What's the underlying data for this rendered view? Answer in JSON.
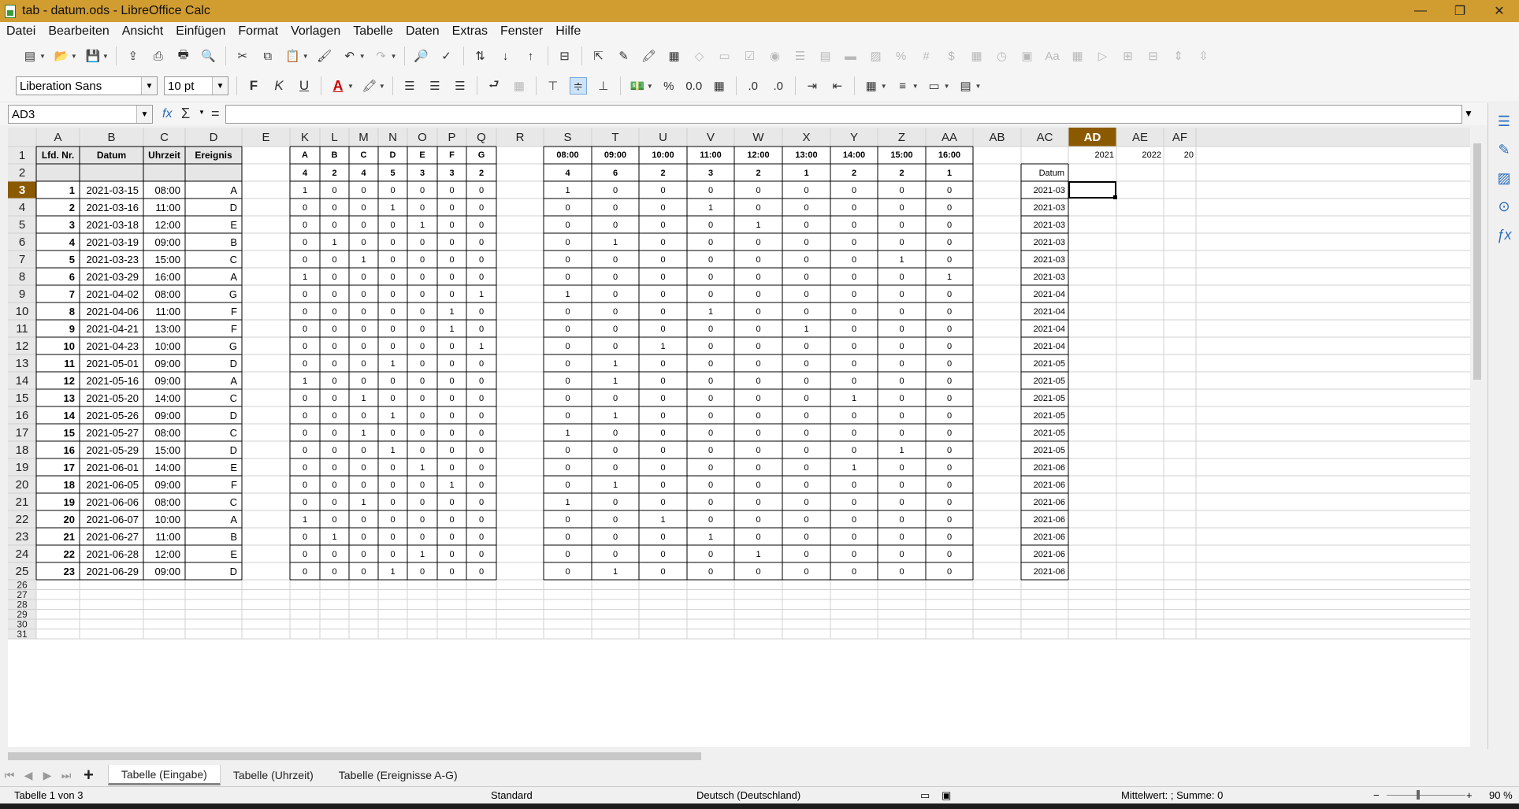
{
  "window": {
    "title": "tab - datum.ods - LibreOffice Calc",
    "minimize": "—",
    "restore": "❐",
    "close": "✕"
  },
  "menu": [
    "Datei",
    "Bearbeiten",
    "Ansicht",
    "Einfügen",
    "Format",
    "Vorlagen",
    "Tabelle",
    "Daten",
    "Extras",
    "Fenster",
    "Hilfe"
  ],
  "toolbar": {
    "font_name": "Liberation Sans",
    "font_size": "10 pt",
    "bold": "F",
    "italic": "K",
    "underline": "U",
    "percent": "%",
    "num_fmt": "0.0"
  },
  "formula_bar": {
    "cell_ref": "AD3",
    "fx": "fx",
    "sigma": "Σ",
    "equals": "=",
    "content": ""
  },
  "columns": [
    "A",
    "B",
    "C",
    "D",
    "E",
    "K",
    "L",
    "M",
    "N",
    "O",
    "P",
    "Q",
    "R",
    "S",
    "T",
    "U",
    "V",
    "W",
    "X",
    "Y",
    "Z",
    "AA",
    "AB",
    "AC",
    "AD",
    "AE",
    "AF"
  ],
  "selected_column": "AD",
  "selected_row": 3,
  "header_row": {
    "A": "Lfd. Nr.",
    "B": "Datum",
    "C": "Uhrzeit",
    "D": "Ereignis",
    "events": [
      "A",
      "B",
      "C",
      "D",
      "E",
      "F",
      "G"
    ],
    "times": [
      "08:00",
      "09:00",
      "10:00",
      "11:00",
      "12:00",
      "13:00",
      "14:00",
      "15:00",
      "16:00"
    ],
    "AD": "2021",
    "AE": "2022",
    "AF": "20"
  },
  "sums_row": {
    "events": [
      "4",
      "2",
      "4",
      "5",
      "3",
      "3",
      "2"
    ],
    "times": [
      "4",
      "6",
      "2",
      "3",
      "2",
      "1",
      "2",
      "2",
      "1"
    ],
    "AC": "Datum"
  },
  "rows": [
    {
      "nr": "1",
      "datum": "2021-03-15",
      "zeit": "08:00",
      "ev": "A",
      "e": [
        1,
        0,
        0,
        0,
        0,
        0,
        0
      ],
      "t": [
        1,
        0,
        0,
        0,
        0,
        0,
        0,
        0,
        0
      ],
      "ym": "2021-03"
    },
    {
      "nr": "2",
      "datum": "2021-03-16",
      "zeit": "11:00",
      "ev": "D",
      "e": [
        0,
        0,
        0,
        1,
        0,
        0,
        0
      ],
      "t": [
        0,
        0,
        0,
        1,
        0,
        0,
        0,
        0,
        0
      ],
      "ym": "2021-03"
    },
    {
      "nr": "3",
      "datum": "2021-03-18",
      "zeit": "12:00",
      "ev": "E",
      "e": [
        0,
        0,
        0,
        0,
        1,
        0,
        0
      ],
      "t": [
        0,
        0,
        0,
        0,
        1,
        0,
        0,
        0,
        0
      ],
      "ym": "2021-03"
    },
    {
      "nr": "4",
      "datum": "2021-03-19",
      "zeit": "09:00",
      "ev": "B",
      "e": [
        0,
        1,
        0,
        0,
        0,
        0,
        0
      ],
      "t": [
        0,
        1,
        0,
        0,
        0,
        0,
        0,
        0,
        0
      ],
      "ym": "2021-03"
    },
    {
      "nr": "5",
      "datum": "2021-03-23",
      "zeit": "15:00",
      "ev": "C",
      "e": [
        0,
        0,
        1,
        0,
        0,
        0,
        0
      ],
      "t": [
        0,
        0,
        0,
        0,
        0,
        0,
        0,
        1,
        0
      ],
      "ym": "2021-03"
    },
    {
      "nr": "6",
      "datum": "2021-03-29",
      "zeit": "16:00",
      "ev": "A",
      "e": [
        1,
        0,
        0,
        0,
        0,
        0,
        0
      ],
      "t": [
        0,
        0,
        0,
        0,
        0,
        0,
        0,
        0,
        1
      ],
      "ym": "2021-03"
    },
    {
      "nr": "7",
      "datum": "2021-04-02",
      "zeit": "08:00",
      "ev": "G",
      "e": [
        0,
        0,
        0,
        0,
        0,
        0,
        1
      ],
      "t": [
        1,
        0,
        0,
        0,
        0,
        0,
        0,
        0,
        0
      ],
      "ym": "2021-04"
    },
    {
      "nr": "8",
      "datum": "2021-04-06",
      "zeit": "11:00",
      "ev": "F",
      "e": [
        0,
        0,
        0,
        0,
        0,
        1,
        0
      ],
      "t": [
        0,
        0,
        0,
        1,
        0,
        0,
        0,
        0,
        0
      ],
      "ym": "2021-04"
    },
    {
      "nr": "9",
      "datum": "2021-04-21",
      "zeit": "13:00",
      "ev": "F",
      "e": [
        0,
        0,
        0,
        0,
        0,
        1,
        0
      ],
      "t": [
        0,
        0,
        0,
        0,
        0,
        1,
        0,
        0,
        0
      ],
      "ym": "2021-04"
    },
    {
      "nr": "10",
      "datum": "2021-04-23",
      "zeit": "10:00",
      "ev": "G",
      "e": [
        0,
        0,
        0,
        0,
        0,
        0,
        1
      ],
      "t": [
        0,
        0,
        1,
        0,
        0,
        0,
        0,
        0,
        0
      ],
      "ym": "2021-04"
    },
    {
      "nr": "11",
      "datum": "2021-05-01",
      "zeit": "09:00",
      "ev": "D",
      "e": [
        0,
        0,
        0,
        1,
        0,
        0,
        0
      ],
      "t": [
        0,
        1,
        0,
        0,
        0,
        0,
        0,
        0,
        0
      ],
      "ym": "2021-05"
    },
    {
      "nr": "12",
      "datum": "2021-05-16",
      "zeit": "09:00",
      "ev": "A",
      "e": [
        1,
        0,
        0,
        0,
        0,
        0,
        0
      ],
      "t": [
        0,
        1,
        0,
        0,
        0,
        0,
        0,
        0,
        0
      ],
      "ym": "2021-05"
    },
    {
      "nr": "13",
      "datum": "2021-05-20",
      "zeit": "14:00",
      "ev": "C",
      "e": [
        0,
        0,
        1,
        0,
        0,
        0,
        0
      ],
      "t": [
        0,
        0,
        0,
        0,
        0,
        0,
        1,
        0,
        0
      ],
      "ym": "2021-05"
    },
    {
      "nr": "14",
      "datum": "2021-05-26",
      "zeit": "09:00",
      "ev": "D",
      "e": [
        0,
        0,
        0,
        1,
        0,
        0,
        0
      ],
      "t": [
        0,
        1,
        0,
        0,
        0,
        0,
        0,
        0,
        0
      ],
      "ym": "2021-05"
    },
    {
      "nr": "15",
      "datum": "2021-05-27",
      "zeit": "08:00",
      "ev": "C",
      "e": [
        0,
        0,
        1,
        0,
        0,
        0,
        0
      ],
      "t": [
        1,
        0,
        0,
        0,
        0,
        0,
        0,
        0,
        0
      ],
      "ym": "2021-05"
    },
    {
      "nr": "16",
      "datum": "2021-05-29",
      "zeit": "15:00",
      "ev": "D",
      "e": [
        0,
        0,
        0,
        1,
        0,
        0,
        0
      ],
      "t": [
        0,
        0,
        0,
        0,
        0,
        0,
        0,
        1,
        0
      ],
      "ym": "2021-05"
    },
    {
      "nr": "17",
      "datum": "2021-06-01",
      "zeit": "14:00",
      "ev": "E",
      "e": [
        0,
        0,
        0,
        0,
        1,
        0,
        0
      ],
      "t": [
        0,
        0,
        0,
        0,
        0,
        0,
        1,
        0,
        0
      ],
      "ym": "2021-06"
    },
    {
      "nr": "18",
      "datum": "2021-06-05",
      "zeit": "09:00",
      "ev": "F",
      "e": [
        0,
        0,
        0,
        0,
        0,
        1,
        0
      ],
      "t": [
        0,
        1,
        0,
        0,
        0,
        0,
        0,
        0,
        0
      ],
      "ym": "2021-06"
    },
    {
      "nr": "19",
      "datum": "2021-06-06",
      "zeit": "08:00",
      "ev": "C",
      "e": [
        0,
        0,
        1,
        0,
        0,
        0,
        0
      ],
      "t": [
        1,
        0,
        0,
        0,
        0,
        0,
        0,
        0,
        0
      ],
      "ym": "2021-06"
    },
    {
      "nr": "20",
      "datum": "2021-06-07",
      "zeit": "10:00",
      "ev": "A",
      "e": [
        1,
        0,
        0,
        0,
        0,
        0,
        0
      ],
      "t": [
        0,
        0,
        1,
        0,
        0,
        0,
        0,
        0,
        0
      ],
      "ym": "2021-06"
    },
    {
      "nr": "21",
      "datum": "2021-06-27",
      "zeit": "11:00",
      "ev": "B",
      "e": [
        0,
        1,
        0,
        0,
        0,
        0,
        0
      ],
      "t": [
        0,
        0,
        0,
        1,
        0,
        0,
        0,
        0,
        0
      ],
      "ym": "2021-06"
    },
    {
      "nr": "22",
      "datum": "2021-06-28",
      "zeit": "12:00",
      "ev": "E",
      "e": [
        0,
        0,
        0,
        0,
        1,
        0,
        0
      ],
      "t": [
        0,
        0,
        0,
        0,
        1,
        0,
        0,
        0,
        0
      ],
      "ym": "2021-06"
    },
    {
      "nr": "23",
      "datum": "2021-06-29",
      "zeit": "09:00",
      "ev": "D",
      "e": [
        0,
        0,
        0,
        1,
        0,
        0,
        0
      ],
      "t": [
        0,
        1,
        0,
        0,
        0,
        0,
        0,
        0,
        0
      ],
      "ym": "2021-06"
    }
  ],
  "empty_rows": [
    "26",
    "27",
    "28",
    "29",
    "30",
    "31"
  ],
  "sheets": [
    {
      "label": "Tabelle (Eingabe)",
      "active": true
    },
    {
      "label": "Tabelle (Uhrzeit)",
      "active": false
    },
    {
      "label": "Tabelle (Ereignisse A-G)",
      "active": false
    }
  ],
  "status": {
    "sheet": "Tabelle 1 von 3",
    "style": "Standard",
    "language": "Deutsch (Deutschland)",
    "summary": "Mittelwert: ; Summe: 0",
    "zoom": "90 %"
  },
  "colors": {
    "titlebar": "#d19c30",
    "selection": "#8b5a00",
    "header_bg": "#e8e8e8"
  }
}
